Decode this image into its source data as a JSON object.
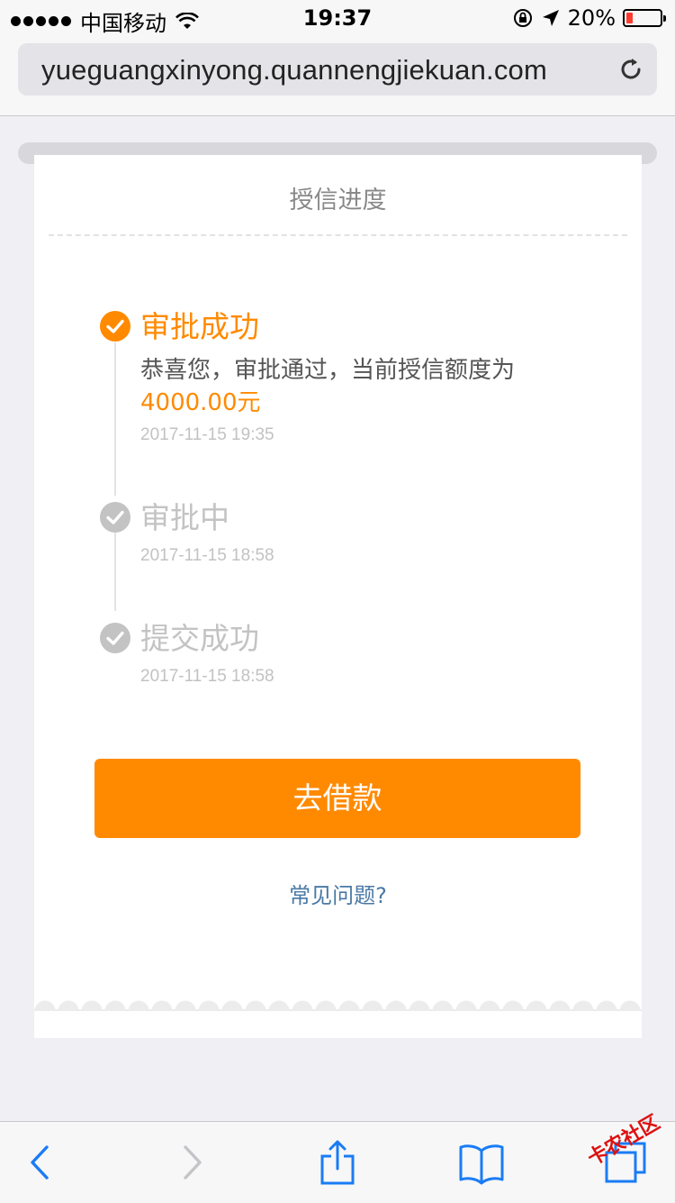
{
  "status": {
    "carrier": "中国移动",
    "time": "19:37",
    "battery_pct": "20%",
    "battery_level": 0.2,
    "battery_color": "#ff3b30"
  },
  "browser": {
    "url": "yueguangxinyong.quannengjiekuan.com"
  },
  "page": {
    "title": "授信进度",
    "steps": [
      {
        "status": "审批成功",
        "message": "恭喜您，审批通过，当前授信额度为",
        "amount": "4000.00元",
        "time": "2017-11-15 19:35",
        "active": true
      },
      {
        "status": "审批中",
        "time": "2017-11-15 18:58",
        "active": false
      },
      {
        "status": "提交成功",
        "time": "2017-11-15 18:58",
        "active": false
      }
    ],
    "borrow_button": "去借款",
    "faq_link": "常见问题?"
  },
  "colors": {
    "accent": "#ff8a00",
    "inactive": "#c3c3c3",
    "link": "#4a79a5",
    "toolbar_icon": "#1a7cf5"
  },
  "watermark": "卡农社区"
}
